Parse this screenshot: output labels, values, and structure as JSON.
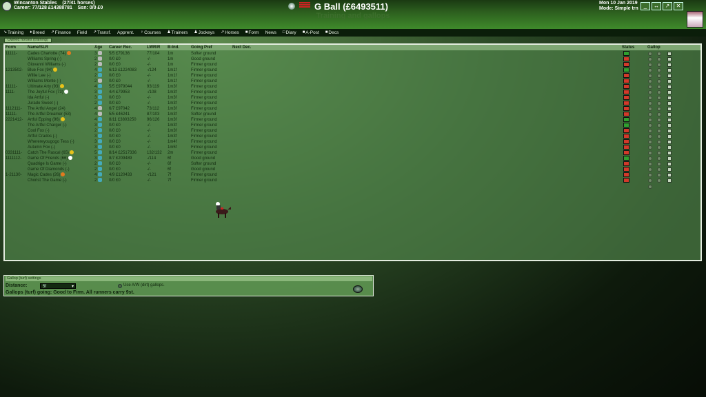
{
  "top": {
    "stable": "Wincanton Stables",
    "horses_count": "(27/41 horses)",
    "career": "Career: 77/128 £14388781",
    "season": "Ssn: 0/0 £0",
    "player_name": "G Ball",
    "balance": "(£6493511)",
    "title": "Training and gallops",
    "date": "Mon 10 Jan 2019",
    "mode": "Mode: Simple trn",
    "win_buttons": [
      "_",
      "↔",
      "↗",
      "✕"
    ]
  },
  "nav": [
    {
      "label": "Training",
      "icon": "↘"
    },
    {
      "label": "Breed",
      "icon": "♦"
    },
    {
      "label": "Finance",
      "icon": "↗"
    },
    {
      "label": "Field",
      "icon": ""
    },
    {
      "label": "Transf.",
      "icon": "↗"
    },
    {
      "label": "Apprent.",
      "icon": ""
    },
    {
      "label": "Courses",
      "icon": "♀"
    },
    {
      "label": "Trainers",
      "icon": "♟"
    },
    {
      "label": "Jockeys",
      "icon": "♟"
    },
    {
      "label": "Horses",
      "icon": "↗"
    },
    {
      "label": "Form",
      "icon": "■"
    },
    {
      "label": "News",
      "icon": ""
    },
    {
      "label": "Diary",
      "icon": "□"
    },
    {
      "label": "A-Post",
      "icon": "■"
    },
    {
      "label": "Decs",
      "icon": "■"
    }
  ],
  "subtab": "Owned horses (training)",
  "columns": {
    "form": "Form",
    "name": "Name/SLR",
    "age": "Age",
    "career": "Career Rec.",
    "lwr": "LWR/R",
    "bind": "B-Ind.",
    "going": "Going Pref",
    "nextdec": "Next Dec.",
    "status": "Status",
    "gallop": "Gallop"
  },
  "horses": [
    {
      "form": "11111-",
      "name": "Cades Charlotte (74)",
      "badge": "#e27a1f",
      "age": "3",
      "sex": "#bbb",
      "career": "5/5 £79136",
      "lwr": "77/104",
      "bind": "1m",
      "going": "Softer ground",
      "status": "green",
      "gallop": [
        1,
        1,
        1
      ]
    },
    {
      "form": "",
      "name": "Williams Spring (-)",
      "badge": "",
      "age": "2",
      "sex": "#bbb",
      "career": "0/0 £0",
      "lwr": "-/-",
      "bind": "1m",
      "going": "Good ground",
      "status": "red",
      "gallop": [
        1,
        1,
        1
      ]
    },
    {
      "form": "",
      "name": "Giovanni Williams (-)",
      "badge": "",
      "age": "2",
      "sex": "#bbb",
      "career": "0/0 £0",
      "lwr": "-/-",
      "bind": "1m",
      "going": "Firmer ground",
      "status": "red",
      "gallop": [
        1,
        1,
        1
      ]
    },
    {
      "form": "1213502-",
      "name": "Blue Fox (94)",
      "badge": "#e8c21a",
      "age": "4",
      "sex": "#4ab",
      "career": "6/13 £1224083",
      "lwr": "-/124",
      "bind": "1m1f",
      "going": "Firmer ground",
      "status": "green",
      "gallop": [
        1,
        1,
        1
      ]
    },
    {
      "form": "",
      "name": "Willie Lee (-)",
      "badge": "",
      "age": "2",
      "sex": "#4ab",
      "career": "0/0 £0",
      "lwr": "-/-",
      "bind": "1m1f",
      "going": "Firmer ground",
      "status": "red",
      "gallop": [
        1,
        1,
        1
      ]
    },
    {
      "form": "",
      "name": "Williams Monte (-)",
      "badge": "",
      "age": "2",
      "sex": "#bbb",
      "career": "0/0 £0",
      "lwr": "-/-",
      "bind": "1m1f",
      "going": "Firmer ground",
      "status": "red",
      "gallop": [
        1,
        1,
        1
      ]
    },
    {
      "form": "11111-",
      "name": "Ultimate Arty (93)",
      "badge": "#e8c21a",
      "age": "4",
      "sex": "#4ab",
      "career": "5/5 £979044",
      "lwr": "93/119",
      "bind": "1m3f",
      "going": "Firmer ground",
      "status": "red",
      "gallop": [
        1,
        1,
        1
      ]
    },
    {
      "form": "1111-",
      "name": "The Joyful Fox (73)",
      "badge": "#fff",
      "age": "3",
      "sex": "#4ab",
      "career": "4/4 £79953",
      "lwr": "-/108",
      "bind": "1m3f",
      "going": "Firmer ground",
      "status": "red",
      "gallop": [
        1,
        1,
        1
      ]
    },
    {
      "form": "",
      "name": "Ida Artful (-)",
      "badge": "",
      "age": "3",
      "sex": "#4ab",
      "career": "0/0 £0",
      "lwr": "-/-",
      "bind": "1m3f",
      "going": "Firmer ground",
      "status": "red",
      "gallop": [
        1,
        1,
        1
      ]
    },
    {
      "form": "",
      "name": "Jurado Sweet (-)",
      "badge": "",
      "age": "2",
      "sex": "#4ab",
      "career": "0/0 £0",
      "lwr": "-/-",
      "bind": "1m3f",
      "going": "Firmer ground",
      "status": "red",
      "gallop": [
        1,
        1,
        1
      ]
    },
    {
      "form": "1112111-",
      "name": "The Artful Angel (24)",
      "badge": "",
      "age": "4",
      "sex": "#bbb",
      "career": "6/7 £97042",
      "lwr": "73/112",
      "bind": "1m3f",
      "going": "Firmer ground",
      "status": "red",
      "gallop": [
        1,
        1,
        1
      ]
    },
    {
      "form": "11111-",
      "name": "The Artful Dreamer (53)",
      "badge": "",
      "age": "4",
      "sex": "#bbb",
      "career": "5/5 £46241",
      "lwr": "87/103",
      "bind": "1m3f",
      "going": "Softer ground",
      "status": "red",
      "gallop": [
        1,
        1,
        1
      ]
    },
    {
      "form": "2221412-",
      "name": "Artful Epping (96)",
      "badge": "#e8c21a",
      "age": "4",
      "sex": "#4ab",
      "career": "8/11 £3803250",
      "lwr": "96/126",
      "bind": "1m3f",
      "going": "Firmer ground",
      "status": "green",
      "gallop": [
        1,
        1,
        1
      ]
    },
    {
      "form": "",
      "name": "The Artful Charger (-)",
      "badge": "",
      "age": "3",
      "sex": "#4ab",
      "career": "0/0 £0",
      "lwr": "-/-",
      "bind": "1m3f",
      "going": "Firmer ground",
      "status": "green",
      "gallop": [
        1,
        1,
        1
      ]
    },
    {
      "form": "",
      "name": "Cool Fox (-)",
      "badge": "",
      "age": "2",
      "sex": "#4ab",
      "career": "0/0 £0",
      "lwr": "-/-",
      "bind": "1m3f",
      "going": "Firmer ground",
      "status": "red",
      "gallop": [
        1,
        1,
        1
      ]
    },
    {
      "form": "",
      "name": "Artful Crados (-)",
      "badge": "",
      "age": "3",
      "sex": "#4ab",
      "career": "0/0 £0",
      "lwr": "-/-",
      "bind": "1m3f",
      "going": "Firmer ground",
      "status": "red",
      "gallop": [
        1,
        1,
        1
      ]
    },
    {
      "form": "",
      "name": "Wherereyougogo Tess (-)",
      "badge": "",
      "age": "3",
      "sex": "#4ab",
      "career": "0/0 £0",
      "lwr": "-/-",
      "bind": "1m4f",
      "going": "Firmer ground",
      "status": "red",
      "gallop": [
        1,
        1,
        1
      ]
    },
    {
      "form": "",
      "name": "Autumn Fox (-)",
      "badge": "",
      "age": "3",
      "sex": "#4ab",
      "career": "0/0 £0",
      "lwr": "-/-",
      "bind": "1m5f",
      "going": "Firmer ground",
      "status": "red",
      "gallop": [
        1,
        1,
        1
      ]
    },
    {
      "form": "0331111-",
      "name": "Catch The Rascal (65)",
      "badge": "#e8c21a",
      "age": "5",
      "sex": "#4ab",
      "career": "8/14 £2517336",
      "lwr": "132/132",
      "bind": "2m",
      "going": "Firmer ground",
      "status": "red",
      "gallop": [
        1,
        1,
        1
      ]
    },
    {
      "form": "1111112-",
      "name": "Game Of Friends (66)",
      "badge": "#fff",
      "age": "3",
      "sex": "#4ab",
      "career": "8/7 £209489",
      "lwr": "-/114",
      "bind": "6f",
      "going": "Good ground",
      "status": "green",
      "gallop": [
        1,
        1,
        1
      ]
    },
    {
      "form": "",
      "name": "Quadrige Is Game (-)",
      "badge": "",
      "age": "2",
      "sex": "#4ab",
      "career": "0/0 £0",
      "lwr": "-/-",
      "bind": "6f",
      "going": "Softer ground",
      "status": "red",
      "gallop": [
        1,
        1,
        1
      ]
    },
    {
      "form": "",
      "name": "Game Of Diamonds (-)",
      "badge": "",
      "age": "2",
      "sex": "#4ab",
      "career": "0/0 £0",
      "lwr": "-/-",
      "bind": "6f",
      "going": "Good ground",
      "status": "red",
      "gallop": [
        1,
        1,
        1
      ]
    },
    {
      "form": "1-21130-",
      "name": "Magic Cades (26)",
      "badge": "#e27a1f",
      "age": "4",
      "sex": "#4ab",
      "career": "4/9 £120433",
      "lwr": "-/121",
      "bind": "7f",
      "going": "Firmer ground",
      "status": "red",
      "gallop": [
        1,
        1,
        1
      ]
    },
    {
      "form": "",
      "name": "Chorist The Game (-)",
      "badge": "",
      "age": "2",
      "sex": "#4ab",
      "career": "0/0 £0",
      "lwr": "-/-",
      "bind": "7f",
      "going": "Firmer ground",
      "status": "red",
      "gallop": [
        1,
        1,
        1
      ]
    }
  ],
  "settings": {
    "title": "Gallop (turf) settings",
    "distance_label": "Distance:",
    "distance_value": "5f",
    "aw_label": "Use A/W (dirt) gallops.",
    "going_text": "Gallops (turf) going: Good to Firm.  All runners carry 9st."
  }
}
